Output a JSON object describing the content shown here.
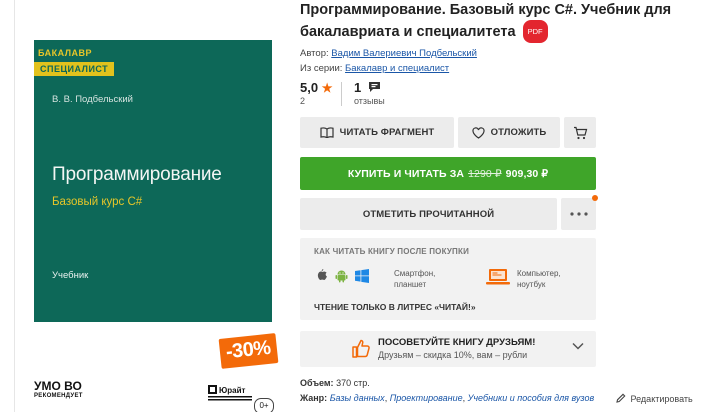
{
  "cover": {
    "badge_top": "БАКАЛАВР",
    "badge_bottom": "СПЕЦИАЛИСТ",
    "author": "В. В. Подбельский",
    "title": "Программирование",
    "subtitle": "Базовый курс C#",
    "type": "Учебник",
    "umo": "УМО ВО",
    "umo_sub": "РЕКОМЕНДУЕТ",
    "publisher": "Юрайт",
    "age": "0+",
    "discount": "-30%"
  },
  "book": {
    "title": "Программирование. Базовый курс С#. Учебник для бакалавриата и специалитета",
    "format_badge": "PDF",
    "author_label": "Автор:",
    "author": "Вадим Валериевич Подбельский",
    "series_label": "Из серии:",
    "series": "Бакалавр и специалист"
  },
  "stats": {
    "rating": "5,0",
    "rating_count": "2",
    "reviews_count": "1",
    "reviews_label": "отзывы"
  },
  "actions": {
    "read_fragment": "ЧИТАТЬ ФРАГМЕНТ",
    "defer": "ОТЛОЖИТЬ",
    "buy_prefix": "КУПИТЬ И ЧИТАТЬ ЗА",
    "old_price": "1290 ₽",
    "price": "909,30 ₽",
    "mark_read": "ОТМЕТИТЬ ПРОЧИТАННОЙ"
  },
  "howto": {
    "title": "КАК ЧИТАТЬ КНИГУ ПОСЛЕ ПОКУПКИ",
    "mobile_line1": "Смартфон,",
    "mobile_line2": "планшет",
    "desktop_line1": "Компьютер,",
    "desktop_line2": "ноутбук",
    "footer": "ЧТЕНИЕ ТОЛЬКО В ЛИТРЕС «ЧИТАЙ!»"
  },
  "recommend": {
    "title": "ПОСОВЕТУЙТЕ КНИГУ ДРУЗЬЯМ!",
    "subtitle": "Друзьям – скидка 10%, вам – рубли"
  },
  "details": {
    "volume_label": "Объем:",
    "volume": "370 стр.",
    "genre_label": "Жанр:",
    "genres": [
      "Базы данных",
      "Проектирование",
      "Учебники и пособия для вузов"
    ],
    "edit": "Редактировать"
  },
  "colors": {
    "cover_green": "#0d6858",
    "accent_yellow": "#e2c21d",
    "brand_orange": "#f36a09",
    "buy_green": "#3fa529",
    "link_blue": "#1a56a7"
  }
}
